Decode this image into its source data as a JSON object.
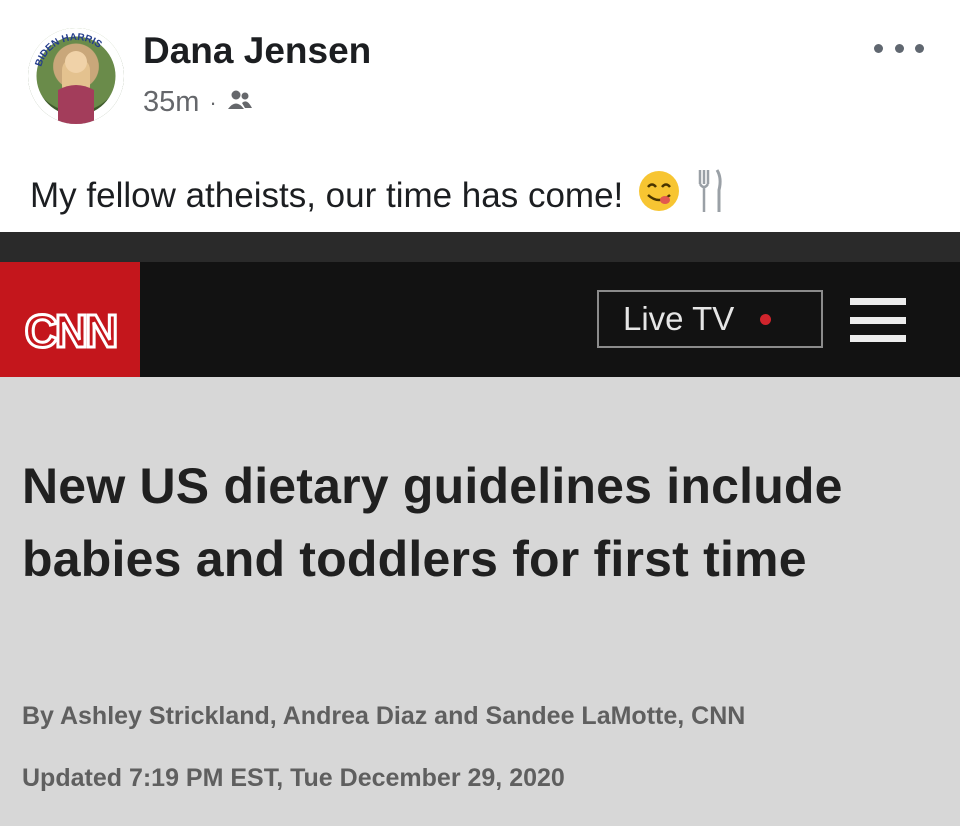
{
  "post": {
    "author": "Dana Jensen",
    "avatar_ring_text": "BIDEN HARRIS",
    "time": "35m",
    "separator": "·",
    "audience_icon": "friends-icon",
    "more_icon": "more-options-icon",
    "text": "My fellow atheists, our time has come!",
    "emojis": [
      "yum-face-icon",
      "fork-and-knife-icon"
    ]
  },
  "cnn": {
    "logo_text": "CNN",
    "live_tv_label": "Live TV",
    "menu_icon": "hamburger-menu-icon",
    "brand_color": "#c4161c",
    "headline": "New US dietary guidelines include babies and toddlers for first time",
    "byline": "By Ashley Strickland, Andrea Diaz and Sandee LaMotte, CNN",
    "updated": "Updated 7:19 PM EST, Tue December 29, 2020"
  }
}
